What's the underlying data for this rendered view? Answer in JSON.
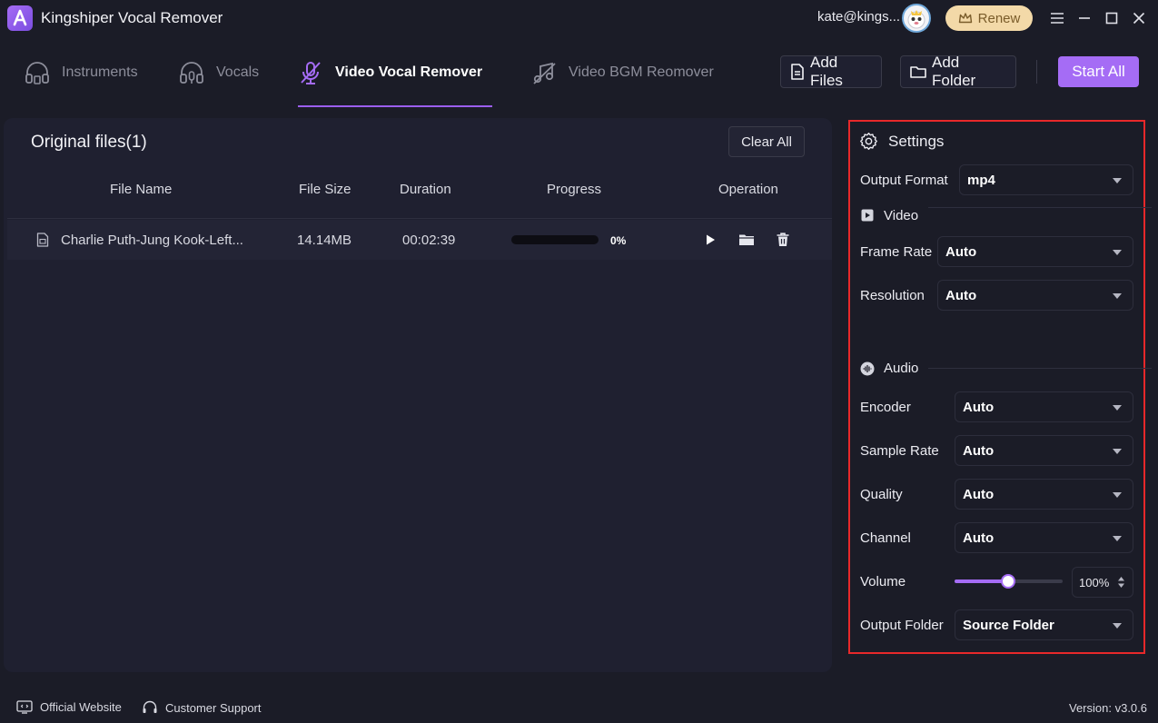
{
  "app": {
    "title": "Kingshiper Vocal Remover",
    "user_email": "kate@kings...",
    "renew_label": "Renew"
  },
  "tabs": [
    {
      "label": "Instruments",
      "icon": "headphones-icon"
    },
    {
      "label": "Vocals",
      "icon": "headphones-mic-icon"
    },
    {
      "label": "Video Vocal Remover",
      "icon": "muted-mic-icon"
    },
    {
      "label": "Video BGM Reomover",
      "icon": "muted-music-icon"
    }
  ],
  "toolbar": {
    "add_files": "Add Files",
    "add_folder": "Add Folder",
    "start_all": "Start All"
  },
  "files_panel": {
    "title": "Original files(1)",
    "clear_all": "Clear All",
    "columns": [
      "File Name",
      "File Size",
      "Duration",
      "Progress",
      "Operation"
    ],
    "rows": [
      {
        "name": "Charlie Puth-Jung Kook-Left...",
        "size": "14.14MB",
        "duration": "00:02:39",
        "progress": 0,
        "progress_text": "0%"
      }
    ]
  },
  "settings": {
    "title": "Settings",
    "output_format": {
      "label": "Output Format",
      "value": "mp4"
    },
    "video_section": "Video",
    "frame_rate": {
      "label": "Frame Rate",
      "value": "Auto"
    },
    "resolution": {
      "label": "Resolution",
      "value": "Auto"
    },
    "audio_section": "Audio",
    "encoder": {
      "label": "Encoder",
      "value": "Auto"
    },
    "sample_rate": {
      "label": "Sample Rate",
      "value": "Auto"
    },
    "quality": {
      "label": "Quality",
      "value": "Auto"
    },
    "channel": {
      "label": "Channel",
      "value": "Auto"
    },
    "volume": {
      "label": "Volume",
      "value": 0.5,
      "text": "100%"
    },
    "output_folder": {
      "label": "Output Folder",
      "value": "Source Folder"
    }
  },
  "footer": {
    "official_website": "Official Website",
    "customer_support": "Customer Support",
    "version": "Version: v3.0.6"
  },
  "colors": {
    "accent": "#a56cf5",
    "background": "#1b1c27",
    "panel": "#1f2030",
    "highlight_border": "#e8282a",
    "renew": "#f3d9a8"
  }
}
